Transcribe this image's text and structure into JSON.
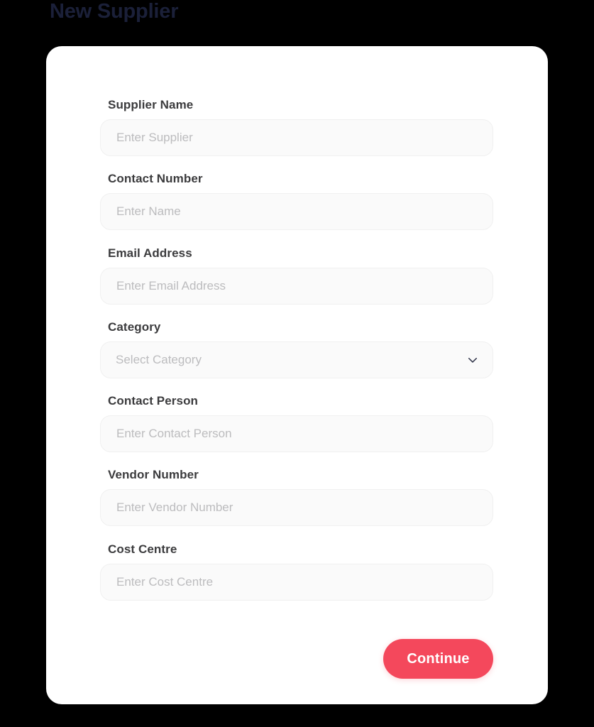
{
  "page": {
    "title": "New Supplier",
    "title_color": "#1b2039",
    "background_color": "#000000",
    "card_background": "#ffffff"
  },
  "form": {
    "fields": [
      {
        "label": "Supplier Name",
        "placeholder": "Enter Supplier",
        "value": "",
        "type": "text"
      },
      {
        "label": "Contact Number",
        "placeholder": "Enter Name",
        "value": "",
        "type": "text"
      },
      {
        "label": "Email Address",
        "placeholder": "Enter Email Address",
        "value": "",
        "type": "text"
      },
      {
        "label": "Category",
        "placeholder": "Select Category",
        "value": "",
        "type": "select",
        "icon": "chevron-down-icon"
      },
      {
        "label": "Contact Person",
        "placeholder": "Enter Contact Person",
        "value": "",
        "type": "text"
      },
      {
        "label": "Vendor Number",
        "placeholder": "Enter Vendor Number",
        "value": "",
        "type": "text"
      },
      {
        "label": "Cost Centre",
        "placeholder": "Enter Cost Centre",
        "value": "",
        "type": "text"
      }
    ]
  },
  "actions": {
    "continue_label": "Continue",
    "continue_color": "#f4485c",
    "continue_text_color": "#ffffff"
  }
}
